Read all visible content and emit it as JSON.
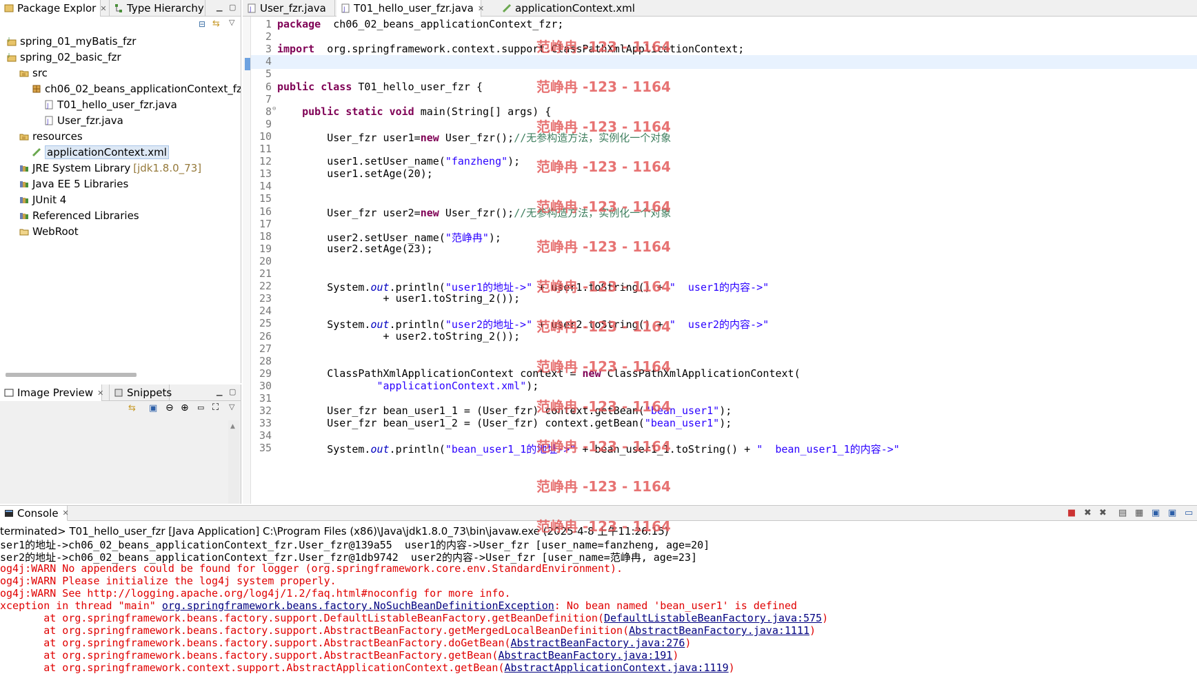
{
  "package_explorer": {
    "tabs": [
      {
        "label": "Package Explor",
        "closable": true
      },
      {
        "label": "Type Hierarchy",
        "closable": false
      }
    ],
    "tree": [
      {
        "label": "spring_01_myBatis_fzr",
        "indent": 0,
        "icon": "project-icon"
      },
      {
        "label": "spring_02_basic_fzr",
        "indent": 0,
        "icon": "project-icon"
      },
      {
        "label": "src",
        "indent": 1,
        "icon": "source-folder-icon"
      },
      {
        "label": "ch06_02_beans_applicationContext_fzr",
        "indent": 2,
        "icon": "package-icon"
      },
      {
        "label": "T01_hello_user_fzr.java",
        "indent": 3,
        "icon": "java-file-icon"
      },
      {
        "label": "User_fzr.java",
        "indent": 3,
        "icon": "java-file-icon"
      },
      {
        "label": "resources",
        "indent": 1,
        "icon": "source-folder-icon"
      },
      {
        "label": "applicationContext.xml",
        "indent": 2,
        "icon": "xml-file-icon",
        "selected": true
      },
      {
        "label": "JRE System Library",
        "decoration": "[jdk1.8.0_73]",
        "indent": 1,
        "icon": "library-icon"
      },
      {
        "label": "Java EE 5 Libraries",
        "indent": 1,
        "icon": "library-icon"
      },
      {
        "label": "JUnit 4",
        "indent": 1,
        "icon": "library-icon"
      },
      {
        "label": "Referenced Libraries",
        "indent": 1,
        "icon": "library-icon"
      },
      {
        "label": "WebRoot",
        "indent": 1,
        "icon": "folder-icon"
      }
    ]
  },
  "image_preview": {
    "tabs": [
      {
        "label": "Image Preview",
        "closable": true
      },
      {
        "label": "Snippets",
        "closable": false
      }
    ]
  },
  "editor": {
    "tabs": [
      {
        "label": "User_fzr.java",
        "closable": false
      },
      {
        "label": "T01_hello_user_fzr.java",
        "closable": true,
        "active": true
      },
      {
        "label": "applicationContext.xml",
        "closable": false
      }
    ],
    "current_line": 4,
    "lines": [
      [
        [
          "kw",
          "package"
        ],
        [
          "",
          "  ch06_02_beans_applicationContext_fzr;"
        ]
      ],
      [],
      [
        [
          "kw",
          "import"
        ],
        [
          "",
          "  org.springframework.context.support.ClassPathXmlApplicationContext;"
        ]
      ],
      [],
      [],
      [
        [
          "kw",
          "public"
        ],
        [
          "",
          " "
        ],
        [
          "kw",
          "class"
        ],
        [
          "",
          " T01_hello_user_fzr {"
        ]
      ],
      [],
      [
        [
          "",
          "    "
        ],
        [
          "kw",
          "public"
        ],
        [
          "",
          " "
        ],
        [
          "kw",
          "static"
        ],
        [
          "",
          " "
        ],
        [
          "kw",
          "void"
        ],
        [
          "",
          " main(String[] args) {"
        ]
      ],
      [],
      [
        [
          "",
          "        User_fzr user1="
        ],
        [
          "kw",
          "new"
        ],
        [
          "",
          " User_fzr();"
        ],
        [
          "cm",
          "//无参构造方法，实例化一个对象"
        ]
      ],
      [],
      [
        [
          "",
          "        user1.setUser_name("
        ],
        [
          "str",
          "\"fanzheng\""
        ],
        [
          "",
          ");"
        ]
      ],
      [
        [
          "",
          "        user1.setAge(20);"
        ]
      ],
      [],
      [],
      [
        [
          "",
          "        User_fzr user2="
        ],
        [
          "kw",
          "new"
        ],
        [
          "",
          " User_fzr();"
        ],
        [
          "cm",
          "//无参构造方法，实例化一个对象"
        ]
      ],
      [],
      [
        [
          "",
          "        user2.setUser_name("
        ],
        [
          "str",
          "\"范峥冉\""
        ],
        [
          "",
          ");"
        ]
      ],
      [
        [
          "",
          "        user2.setAge(23);"
        ]
      ],
      [],
      [],
      [
        [
          "",
          "        System."
        ],
        [
          "fld",
          "out"
        ],
        [
          "",
          ".println("
        ],
        [
          "str",
          "\"user1的地址->\""
        ],
        [
          "",
          " + user1.toString() + "
        ],
        [
          "str",
          "\"  user1的内容->\""
        ]
      ],
      [
        [
          "",
          "                 + user1.toString_2());"
        ]
      ],
      [],
      [
        [
          "",
          "        System."
        ],
        [
          "fld",
          "out"
        ],
        [
          "",
          ".println("
        ],
        [
          "str",
          "\"user2的地址->\""
        ],
        [
          "",
          " + user2.toString() + "
        ],
        [
          "str",
          "\"  user2的内容->\""
        ]
      ],
      [
        [
          "",
          "                 + user2.toString_2());"
        ]
      ],
      [],
      [],
      [
        [
          "",
          "        ClassPathXmlApplicationContext context = "
        ],
        [
          "kw",
          "new"
        ],
        [
          "",
          " ClassPathXmlApplicationContext("
        ]
      ],
      [
        [
          "",
          "                "
        ],
        [
          "str",
          "\"applicationContext.xml\""
        ],
        [
          "",
          ");"
        ]
      ],
      [],
      [
        [
          "",
          "        User_fzr bean_user1_1 = (User_fzr) context.getBean("
        ],
        [
          "str",
          "\"bean_user1\""
        ],
        [
          "",
          ");"
        ]
      ],
      [
        [
          "",
          "        User_fzr bean_user1_2 = (User_fzr) context.getBean("
        ],
        [
          "str",
          "\"bean_user1\""
        ],
        [
          "",
          ");"
        ]
      ],
      [],
      [
        [
          "",
          "        System."
        ],
        [
          "fld",
          "out"
        ],
        [
          "",
          ".println("
        ],
        [
          "str",
          "\"bean_user1_1的地址->\""
        ],
        [
          "",
          " + bean_user1_1.toString() + "
        ],
        [
          "str",
          "\"  bean_user1_1的内容->\""
        ]
      ]
    ]
  },
  "console": {
    "tab_label": "Console",
    "status": "terminated> T01_hello_user_fzr [Java Application] C:\\Program Files (x86)\\Java\\jdk1.8.0_73\\bin\\javaw.exe (2025-4-8 上午11:26:15)",
    "lines": [
      [
        [
          "",
          "ser1的地址->ch06_02_beans_applicationContext_fzr.User_fzr@139a55  user1的内容->User_fzr [user_name=fanzheng, age=20]"
        ]
      ],
      [
        [
          "",
          "ser2的地址->ch06_02_beans_applicationContext_fzr.User_fzr@1db9742  user2的内容->User_fzr [user_name=范峥冉, age=23]"
        ]
      ],
      [
        [
          "err",
          "og4j:WARN No appenders could be found for logger (org.springframework.core.env.StandardEnvironment)."
        ]
      ],
      [
        [
          "err",
          "og4j:WARN Please initialize the log4j system properly."
        ]
      ],
      [
        [
          "err",
          "og4j:WARN See http://logging.apache.org/log4j/1.2/faq.html#noconfig for more info."
        ]
      ],
      [
        [
          "err",
          "xception in thread \"main\" "
        ],
        [
          "lnk",
          "org.springframework.beans.factory.NoSuchBeanDefinitionException"
        ],
        [
          "err",
          ": No bean named 'bean_user1' is defined"
        ]
      ],
      [
        [
          "err",
          "       at org.springframework.beans.factory.support.DefaultListableBeanFactory.getBeanDefinition("
        ],
        [
          "lnk",
          "DefaultListableBeanFactory.java:575"
        ],
        [
          "err",
          ")"
        ]
      ],
      [
        [
          "err",
          "       at org.springframework.beans.factory.support.AbstractBeanFactory.getMergedLocalBeanDefinition("
        ],
        [
          "lnk",
          "AbstractBeanFactory.java:1111"
        ],
        [
          "err",
          ")"
        ]
      ],
      [
        [
          "err",
          "       at org.springframework.beans.factory.support.AbstractBeanFactory.doGetBean("
        ],
        [
          "lnk",
          "AbstractBeanFactory.java:276"
        ],
        [
          "err",
          ")"
        ]
      ],
      [
        [
          "err",
          "       at org.springframework.beans.factory.support.AbstractBeanFactory.getBean("
        ],
        [
          "lnk",
          "AbstractBeanFactory.java:191"
        ],
        [
          "err",
          ")"
        ]
      ],
      [
        [
          "err",
          "       at org.springframework.context.support.AbstractApplicationContext.getBean("
        ],
        [
          "lnk",
          "AbstractApplicationContext.java:1119"
        ],
        [
          "err",
          ")"
        ]
      ]
    ]
  },
  "watermark": "范峥冉 -123 - 1164",
  "colors": {
    "keyword": "#7f0055",
    "string": "#2a00ff",
    "comment": "#3f7f5f",
    "error": "#e00000",
    "watermark": "#e35b5b"
  }
}
